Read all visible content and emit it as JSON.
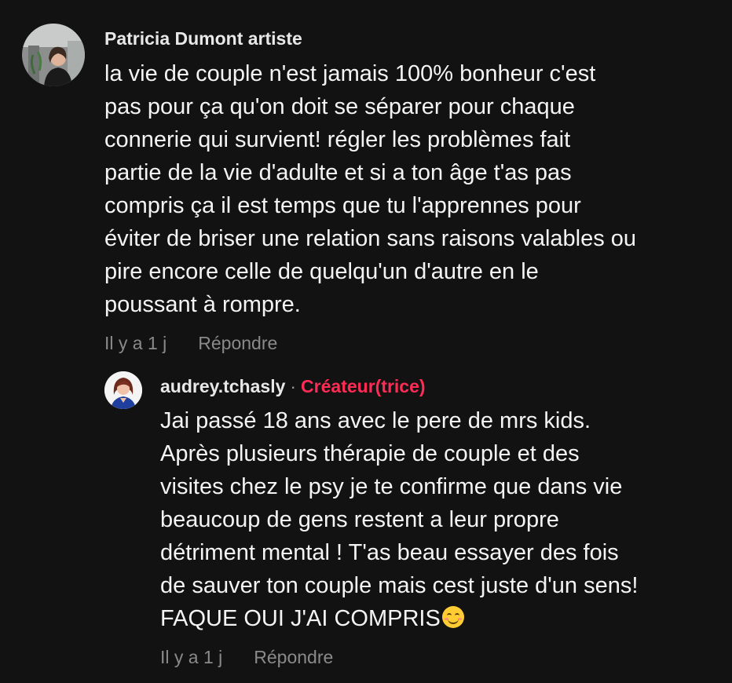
{
  "comment": {
    "author": "Patricia Dumont artiste",
    "text": "la vie de couple n'est jamais 100% bonheur c'est\npas pour ça qu'on doit se séparer pour chaque\nconnerie qui survient! régler les problèmes fait\npartie de la vie d'adulte et si a ton âge t'as pas\ncompris ça il est temps que tu l'apprennes pour\néviter de briser une relation sans raisons valables ou\npire encore celle de quelqu'un d'autre en le\npoussant à rompre.",
    "time": "Il y a 1 j",
    "reply_label": "Répondre"
  },
  "reply": {
    "author": "audrey.tchasly",
    "separator": "·",
    "badge": "Créateur(trice)",
    "text": "Jai passé 18 ans avec le pere de mrs kids.\nAprès plusieurs thérapie de couple et des\nvisites chez le psy je te confirme que dans vie\nbeaucoup de gens restent a leur propre\ndétriment mental ! T'as beau essayer des fois\nde sauver ton couple mais cest juste d'un sens!\nFAQUE OUI J'AI COMPRIS",
    "emoji": "smiling-face-with-smiling-eyes",
    "time": "Il y a 1 j",
    "reply_label": "Répondre"
  },
  "colors": {
    "background": "#121212",
    "creator_badge": "#fe2c55",
    "meta_text": "#8a8a8a"
  }
}
